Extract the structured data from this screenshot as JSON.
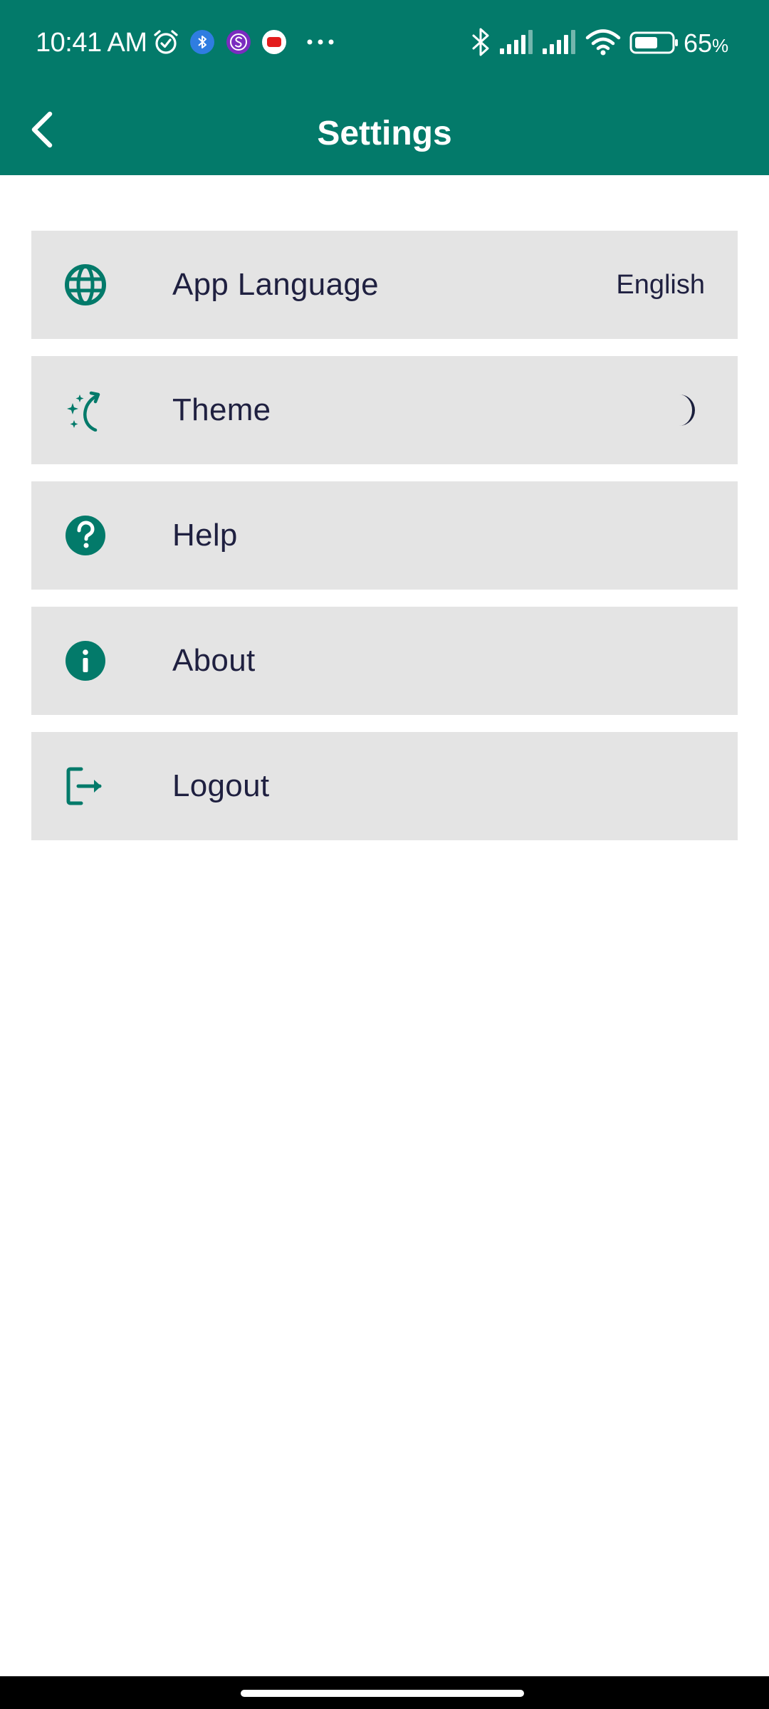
{
  "status_bar": {
    "time": "10:41 AM",
    "battery_percent": "65",
    "battery_percent_sign": "%",
    "icons": [
      "alarm-icon",
      "bluetooth-app-icon",
      "steam-app-icon",
      "youtube-app-icon",
      "more-notifications-icon",
      "bluetooth-icon",
      "signal-icon",
      "signal-icon",
      "wifi-icon",
      "battery-icon"
    ]
  },
  "header": {
    "title": "Settings",
    "back_icon": "chevron-left-icon"
  },
  "settings": {
    "items": [
      {
        "icon": "globe-icon",
        "label": "App Language",
        "value": "English"
      },
      {
        "icon": "theme-icon",
        "label": "Theme",
        "trailing_icon": "moon-icon"
      },
      {
        "icon": "help-icon",
        "label": "Help"
      },
      {
        "icon": "info-icon",
        "label": "About"
      },
      {
        "icon": "logout-icon",
        "label": "Logout"
      }
    ]
  },
  "colors": {
    "primary": "#037a6a",
    "item_background": "#e4e4e4",
    "text": "#1f2040"
  }
}
